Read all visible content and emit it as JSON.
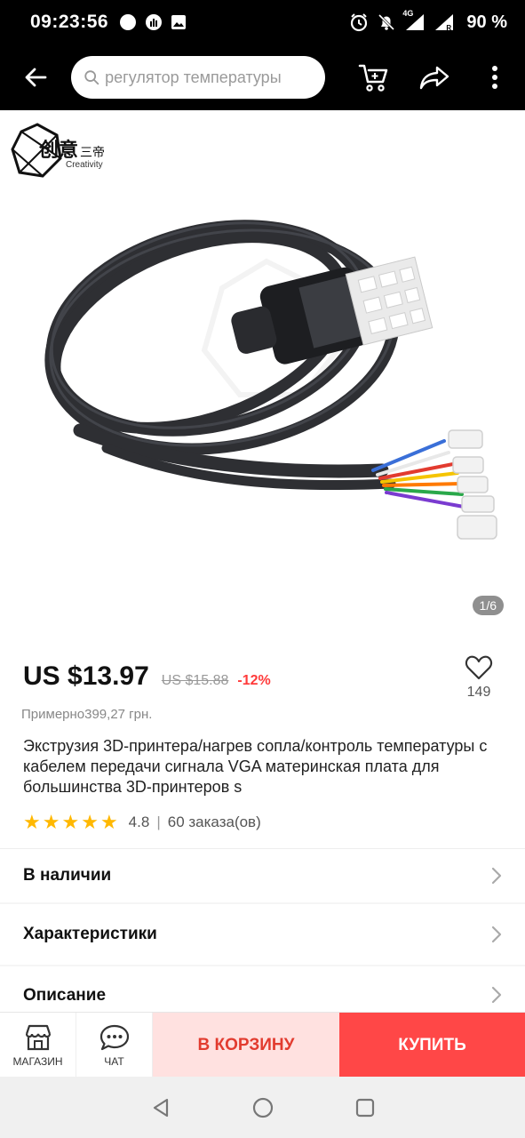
{
  "status_bar": {
    "time": "09:23:56",
    "network": "4G",
    "sim": "R",
    "battery": "90 %"
  },
  "top_bar": {
    "search_placeholder": "регулятор температуры",
    "icons": [
      "back-arrow-icon",
      "search-icon",
      "cart-icon",
      "share-icon",
      "more-icon"
    ]
  },
  "gallery": {
    "counter": "1/6",
    "logo_text": "Creativity"
  },
  "product": {
    "price": "US $13.97",
    "old_price": "US $15.88",
    "discount": "-12%",
    "wishlist_count": "149",
    "approx_price": "Примерно399,27 грн.",
    "title": "Экструзия 3D-принтера/нагрев сопла/контроль температуры с кабелем передачи сигнала VGA материнская плата для большинства 3D-принтеров s",
    "rating": "4.8",
    "rating_separator": "|",
    "orders": "60 заказа(ов)"
  },
  "sections": {
    "availability": "В наличии",
    "specs": "Характеристики",
    "description": "Описание"
  },
  "action_bar": {
    "store_label": "МАГАЗИН",
    "chat_label": "ЧАТ",
    "cart_label": "В КОРЗИНУ",
    "buy_label": "КУПИТЬ"
  },
  "colors": {
    "price_discount": "#ff3a3a",
    "cart_bg": "#ffe1e0",
    "cart_text": "#e23b2f",
    "buy_bg": "#ff4747",
    "star": "#ffb800"
  }
}
